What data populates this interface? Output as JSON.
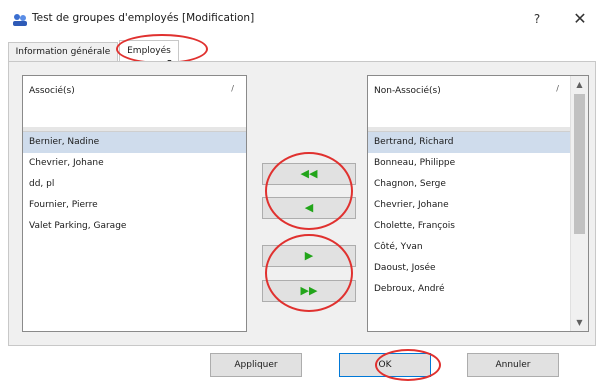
{
  "window": {
    "title": "Test de groupes d'employés [Modification]",
    "help_label": "?",
    "close_label": "✕"
  },
  "tabs": [
    {
      "label": "Information générale"
    },
    {
      "label": "Employés"
    }
  ],
  "associated": {
    "header": "Associé(s)",
    "sort_glyph": "/",
    "items": [
      "Bernier, Nadine",
      "Chevrier, Johane",
      "dd, pl",
      "Fournier, Pierre",
      "Valet Parking, Garage"
    ]
  },
  "not_associated": {
    "header": "Non-Associé(s)",
    "sort_glyph": "/",
    "items": [
      "Bertrand, Richard",
      "Bonneau, Philippe",
      "Chagnon, Serge",
      "Chevrier, Johane",
      "Cholette, François",
      "Côté, Yvan",
      "Daoust, Josée",
      "Debroux, André"
    ]
  },
  "move_buttons": {
    "add_all": "◀◀",
    "add": "◀",
    "remove": "▶",
    "remove_all": "▶▶"
  },
  "buttons": {
    "apply": "Appliquer",
    "ok": "OK",
    "cancel": "Annuler"
  },
  "scroll": {
    "up": "▲",
    "down": "▼"
  },
  "colors": {
    "selection": "#cfdcec",
    "arrow": "#22a51a",
    "annotation": "#e0312f"
  }
}
